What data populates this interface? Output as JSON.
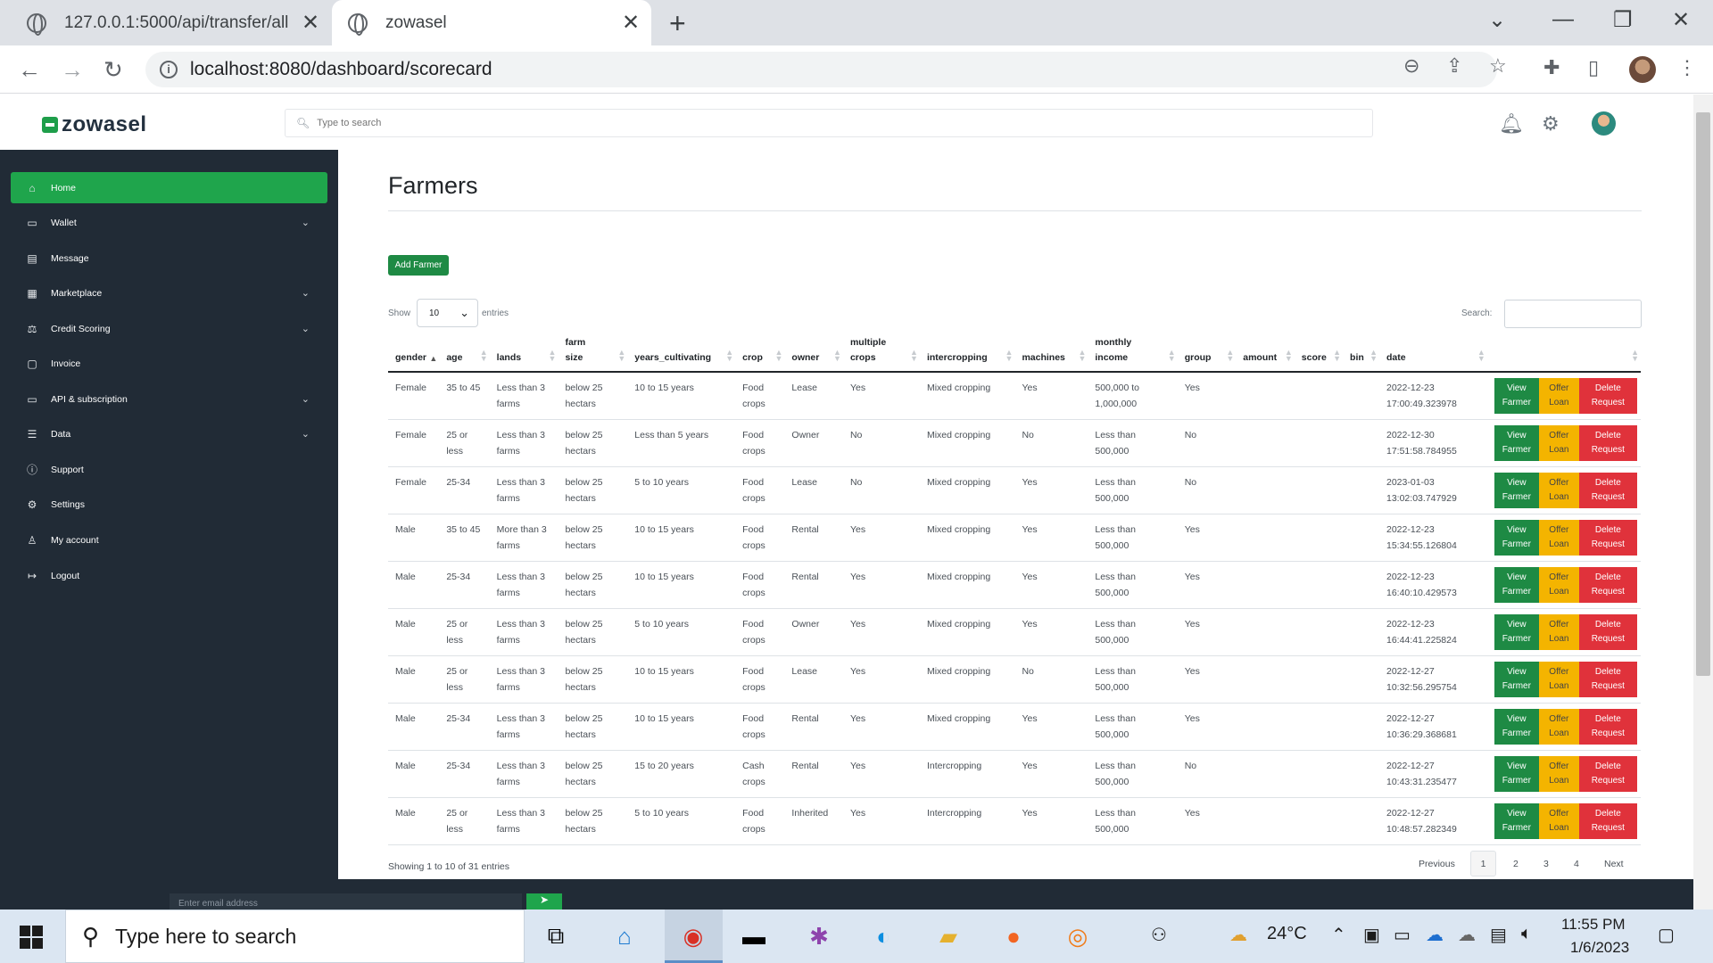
{
  "browser": {
    "tabs": [
      {
        "title": "127.0.0.1:5000/api/transfer/all"
      },
      {
        "title": "zowasel"
      }
    ],
    "url": "localhost:8080/dashboard/scorecard"
  },
  "app": {
    "logo": "zowasel",
    "search_placeholder": "Type to search"
  },
  "sidebar": {
    "items": [
      {
        "label": "Home",
        "icon": "home-icon"
      },
      {
        "label": "Wallet",
        "icon": "wallet-icon"
      },
      {
        "label": "Message",
        "icon": "message-icon"
      },
      {
        "label": "Marketplace",
        "icon": "store-icon"
      },
      {
        "label": "Credit Scoring",
        "icon": "credit-icon"
      },
      {
        "label": "Invoice",
        "icon": "invoice-icon"
      },
      {
        "label": "API & subscription",
        "icon": "folder-icon"
      },
      {
        "label": "Data",
        "icon": "database-icon"
      },
      {
        "label": "Support",
        "icon": "support-icon"
      },
      {
        "label": "Settings",
        "icon": "settings-icon"
      },
      {
        "label": "My account",
        "icon": "user-icon"
      },
      {
        "label": "Logout",
        "icon": "logout-icon"
      }
    ]
  },
  "main": {
    "title": "Farmers",
    "add_button": "Add Farmer",
    "show_label": "Show",
    "entries_value": "10",
    "entries_label": "entries",
    "search_label": "Search:",
    "columns": [
      "gender",
      "age",
      "lands",
      "farm size",
      "years_cultivating",
      "crop",
      "owner",
      "multiple crops",
      "intercropping",
      "machines",
      "monthly income",
      "group",
      "amount",
      "score",
      "bin",
      "date",
      ""
    ],
    "actions": {
      "view": "View Farmer",
      "offer": "Offer Loan",
      "delete": "Delete Request"
    },
    "rows": [
      {
        "gender": "Female",
        "age": "35 to 45",
        "lands": "Less than 3 farms",
        "farm_size": "below 25 hectars",
        "years": "10 to 15 years",
        "crop": "Food crops",
        "owner": "Lease",
        "multiple": "Yes",
        "intercropping": "Mixed cropping",
        "machines": "Yes",
        "income": "500,000 to 1,000,000",
        "group": "Yes",
        "amount": "",
        "score": "",
        "bin": "",
        "date": "2022-12-23 17:00:49.323978"
      },
      {
        "gender": "Female",
        "age": "25 or less",
        "lands": "Less than 3 farms",
        "farm_size": "below 25 hectars",
        "years": "Less than 5 years",
        "crop": "Food crops",
        "owner": "Owner",
        "multiple": "No",
        "intercropping": "Mixed cropping",
        "machines": "No",
        "income": "Less than 500,000",
        "group": "No",
        "amount": "",
        "score": "",
        "bin": "",
        "date": "2022-12-30 17:51:58.784955"
      },
      {
        "gender": "Female",
        "age": "25-34",
        "lands": "Less than 3 farms",
        "farm_size": "below 25 hectars",
        "years": "5 to 10 years",
        "crop": "Food crops",
        "owner": "Lease",
        "multiple": "No",
        "intercropping": "Mixed cropping",
        "machines": "Yes",
        "income": "Less than 500,000",
        "group": "No",
        "amount": "",
        "score": "",
        "bin": "",
        "date": "2023-01-03 13:02:03.747929"
      },
      {
        "gender": "Male",
        "age": "35 to 45",
        "lands": "More than 3 farms",
        "farm_size": "below 25 hectars",
        "years": "10 to 15 years",
        "crop": "Food crops",
        "owner": "Rental",
        "multiple": "Yes",
        "intercropping": "Mixed cropping",
        "machines": "Yes",
        "income": "Less than 500,000",
        "group": "Yes",
        "amount": "",
        "score": "",
        "bin": "",
        "date": "2022-12-23 15:34:55.126804"
      },
      {
        "gender": "Male",
        "age": "25-34",
        "lands": "Less than 3 farms",
        "farm_size": "below 25 hectars",
        "years": "10 to 15 years",
        "crop": "Food crops",
        "owner": "Rental",
        "multiple": "Yes",
        "intercropping": "Mixed cropping",
        "machines": "Yes",
        "income": "Less than 500,000",
        "group": "Yes",
        "amount": "",
        "score": "",
        "bin": "",
        "date": "2022-12-23 16:40:10.429573"
      },
      {
        "gender": "Male",
        "age": "25 or less",
        "lands": "Less than 3 farms",
        "farm_size": "below 25 hectars",
        "years": "5 to 10 years",
        "crop": "Food crops",
        "owner": "Owner",
        "multiple": "Yes",
        "intercropping": "Mixed cropping",
        "machines": "Yes",
        "income": "Less than 500,000",
        "group": "Yes",
        "amount": "",
        "score": "",
        "bin": "",
        "date": "2022-12-23 16:44:41.225824"
      },
      {
        "gender": "Male",
        "age": "25 or less",
        "lands": "Less than 3 farms",
        "farm_size": "below 25 hectars",
        "years": "10 to 15 years",
        "crop": "Food crops",
        "owner": "Lease",
        "multiple": "Yes",
        "intercropping": "Mixed cropping",
        "machines": "No",
        "income": "Less than 500,000",
        "group": "Yes",
        "amount": "",
        "score": "",
        "bin": "",
        "date": "2022-12-27 10:32:56.295754"
      },
      {
        "gender": "Male",
        "age": "25-34",
        "lands": "Less than 3 farms",
        "farm_size": "below 25 hectars",
        "years": "10 to 15 years",
        "crop": "Food crops",
        "owner": "Rental",
        "multiple": "Yes",
        "intercropping": "Mixed cropping",
        "machines": "Yes",
        "income": "Less than 500,000",
        "group": "Yes",
        "amount": "",
        "score": "",
        "bin": "",
        "date": "2022-12-27 10:36:29.368681"
      },
      {
        "gender": "Male",
        "age": "25-34",
        "lands": "Less than 3 farms",
        "farm_size": "below 25 hectars",
        "years": "15 to 20 years",
        "crop": "Cash crops",
        "owner": "Rental",
        "multiple": "Yes",
        "intercropping": "Intercropping",
        "machines": "Yes",
        "income": "Less than 500,000",
        "group": "No",
        "amount": "",
        "score": "",
        "bin": "",
        "date": "2022-12-27 10:43:31.235477"
      },
      {
        "gender": "Male",
        "age": "25 or less",
        "lands": "Less than 3 farms",
        "farm_size": "below 25 hectars",
        "years": "5 to 10 years",
        "crop": "Food crops",
        "owner": "Inherited",
        "multiple": "Yes",
        "intercropping": "Intercropping",
        "machines": "Yes",
        "income": "Less than 500,000",
        "group": "Yes",
        "amount": "",
        "score": "",
        "bin": "",
        "date": "2022-12-27 10:48:57.282349"
      }
    ],
    "showing": "Showing 1 to 10 of 31 entries",
    "pagination": {
      "previous": "Previous",
      "pages": [
        "1",
        "2",
        "3",
        "4"
      ],
      "next": "Next"
    }
  },
  "footer": {
    "email_placeholder": "Enter email address"
  },
  "taskbar": {
    "search_placeholder": "Type here to search",
    "weather": "24°C",
    "time": "11:55 PM",
    "date": "1/6/2023"
  }
}
